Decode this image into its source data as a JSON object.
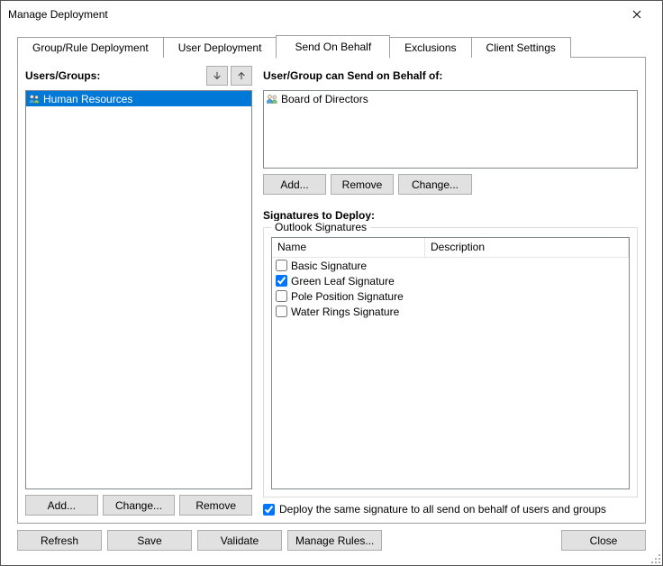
{
  "window": {
    "title": "Manage Deployment"
  },
  "tabs": {
    "t0": "Group/Rule Deployment",
    "t1": "User Deployment",
    "t2": "Send On Behalf",
    "t3": "Exclusions",
    "t4": "Client Settings"
  },
  "left": {
    "label": "Users/Groups:",
    "items": {
      "i0": "Human Resources"
    },
    "btn_add": "Add...",
    "btn_change": "Change...",
    "btn_remove": "Remove"
  },
  "right": {
    "label": "User/Group can Send on Behalf of:",
    "items": {
      "i0": "Board of Directors"
    },
    "btn_add": "Add...",
    "btn_remove": "Remove",
    "btn_change": "Change..."
  },
  "sig": {
    "title": "Signatures to Deploy:",
    "legend": "Outlook Signatures",
    "hdr_name": "Name",
    "hdr_desc": "Description",
    "rows": {
      "r0": "Basic Signature",
      "r1": "Green Leaf Signature",
      "r2": "Pole Position Signature",
      "r3": "Water Rings Signature"
    },
    "deploy_all": "Deploy the same signature to all send on behalf of users and groups"
  },
  "bottom": {
    "refresh": "Refresh",
    "save": "Save",
    "validate": "Validate",
    "rules": "Manage Rules...",
    "close": "Close"
  }
}
